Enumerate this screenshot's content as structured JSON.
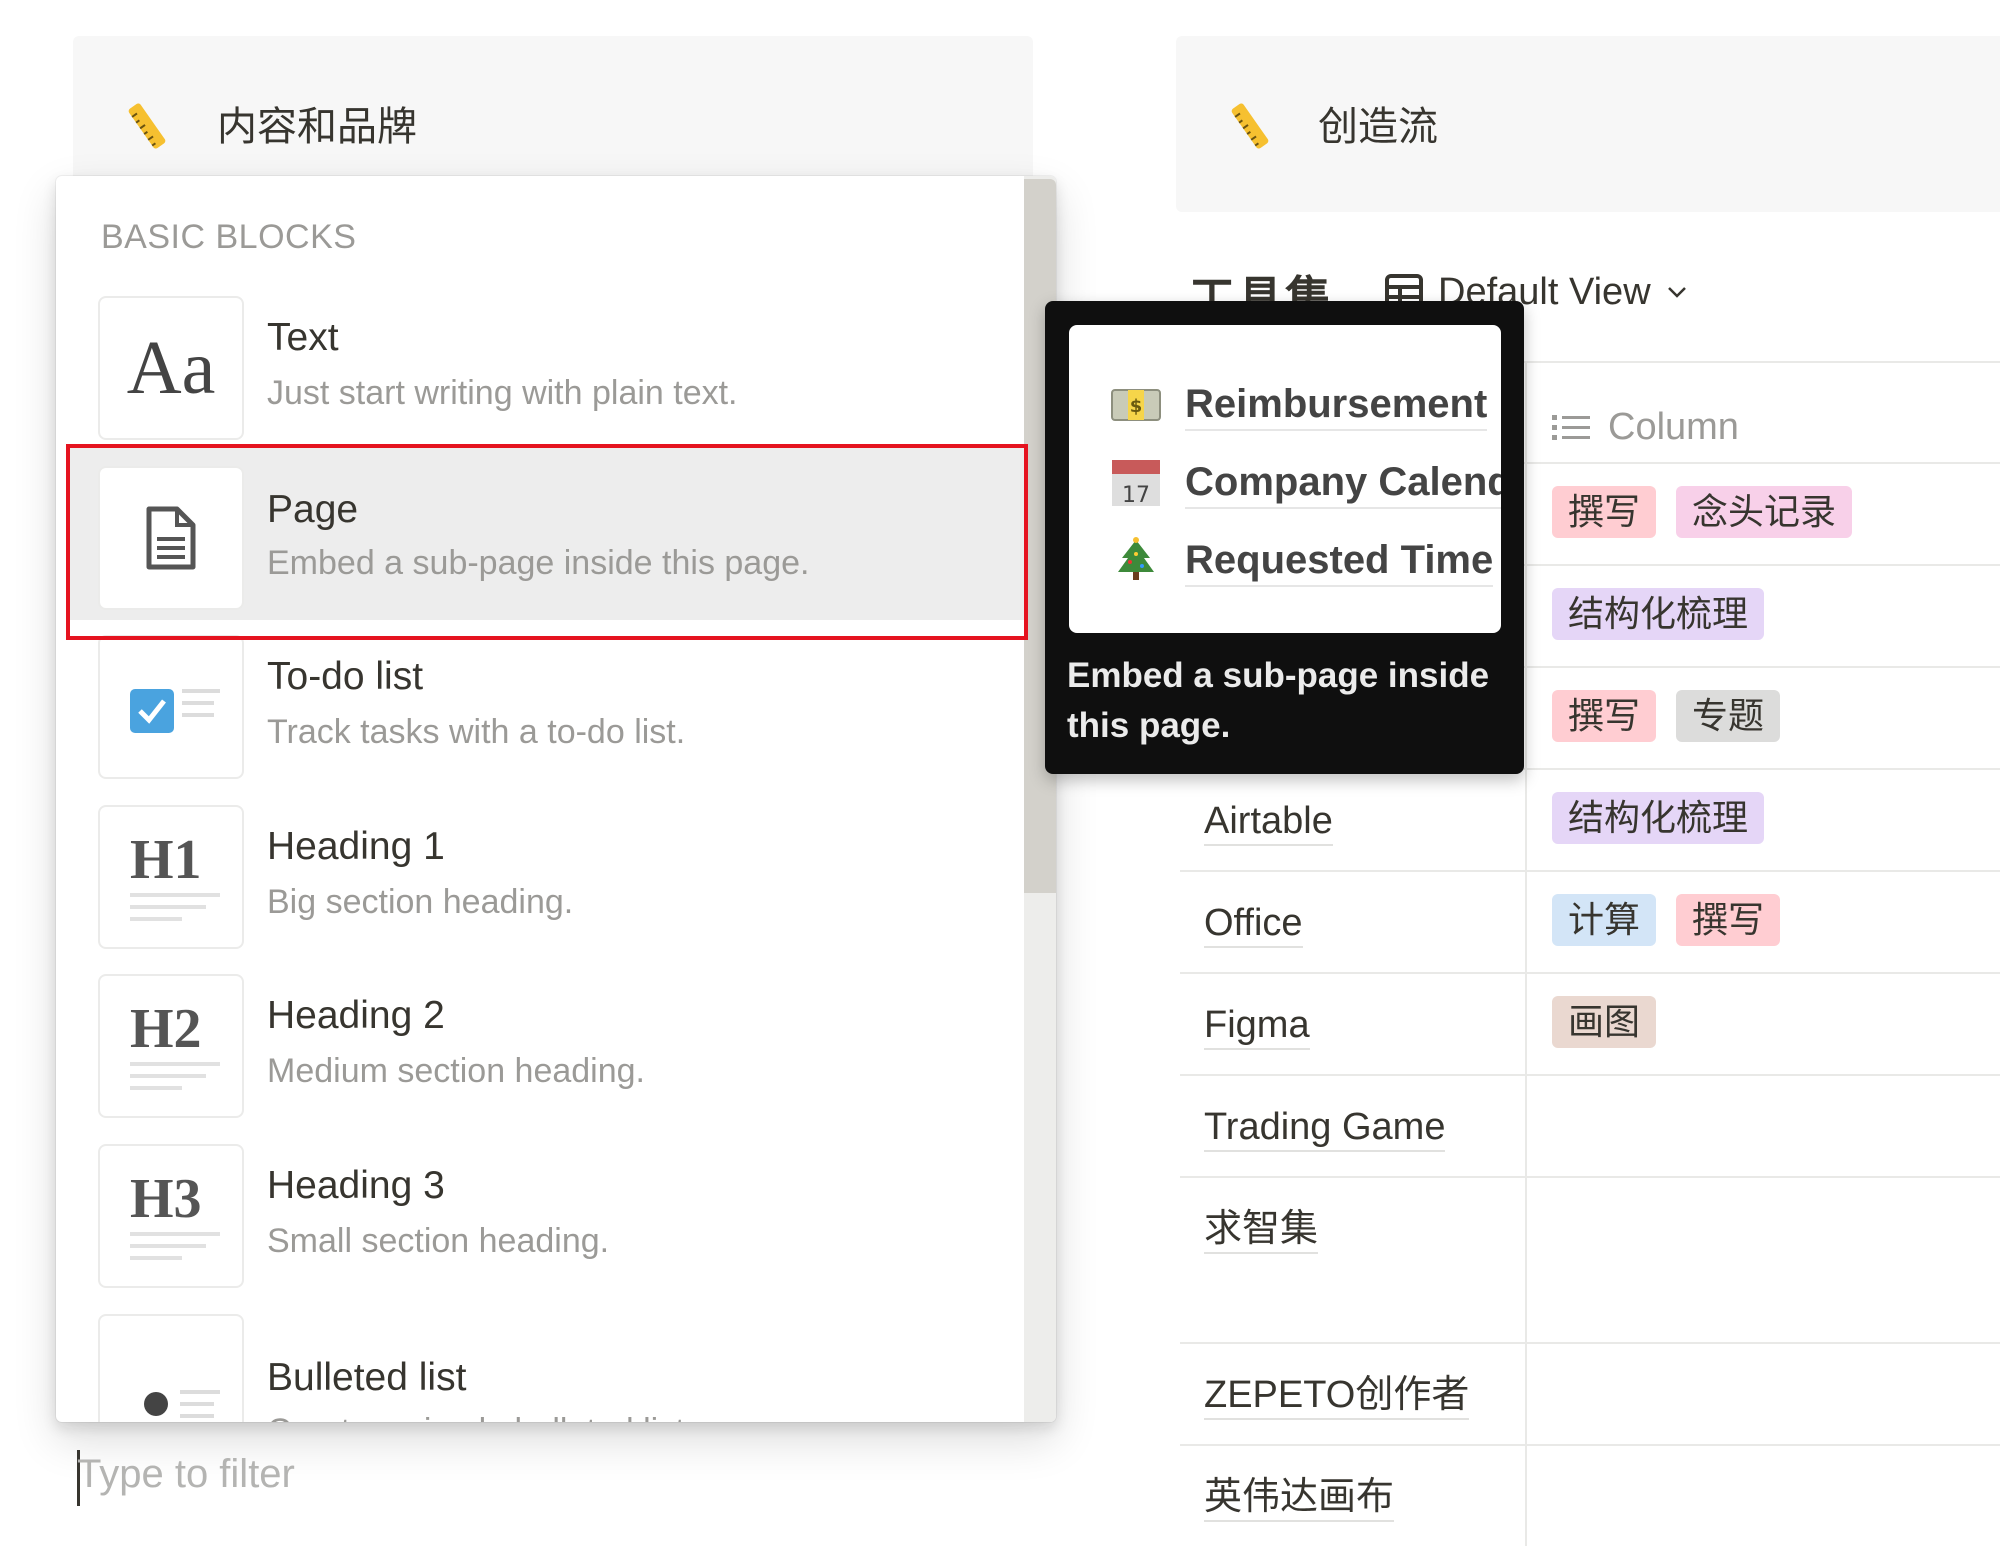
{
  "cards": [
    {
      "icon": "ruler-icon",
      "title": "内容和品牌"
    },
    {
      "icon": "ruler-icon",
      "title": "创造流"
    }
  ],
  "database": {
    "title": "工具集",
    "view": {
      "icon": "table-icon",
      "label": "Default View"
    },
    "column_header": {
      "icon": "multi-select-icon",
      "label": "Column"
    },
    "rows": [
      {
        "name": "",
        "tags": [
          {
            "label": "撰写",
            "color": "#ffcdd2"
          },
          {
            "label": "念头记录",
            "color": "#f8d0e9"
          }
        ]
      },
      {
        "name": "",
        "tags": [
          {
            "label": "结构化梳理",
            "color": "#e5d6f7"
          }
        ]
      },
      {
        "name": "",
        "tags": [
          {
            "label": "撰写",
            "color": "#ffcdd2"
          },
          {
            "label": "专题",
            "color": "#dcdcdb"
          }
        ]
      },
      {
        "name": "Airtable",
        "tags": [
          {
            "label": "结构化梳理",
            "color": "#e5d6f7"
          }
        ]
      },
      {
        "name": "Office",
        "tags": [
          {
            "label": "计算",
            "color": "#d3e5f7"
          },
          {
            "label": "撰写",
            "color": "#ffcdd2"
          }
        ]
      },
      {
        "name": "Figma",
        "tags": [
          {
            "label": "画图",
            "color": "#ead8d0"
          }
        ]
      },
      {
        "name": "Trading Game",
        "tags": []
      },
      {
        "name": "求智集",
        "tags": []
      },
      {
        "name": "ZEPETO创作者",
        "tags": []
      },
      {
        "name": "英伟达画布",
        "tags": []
      }
    ]
  },
  "menu": {
    "section": "BASIC BLOCKS",
    "selected_index": 1,
    "items": [
      {
        "icon": "text-icon",
        "glyph": "Aa",
        "title": "Text",
        "description": "Just start writing with plain text."
      },
      {
        "icon": "page-icon",
        "glyph": "",
        "title": "Page",
        "description": "Embed a sub-page inside this page."
      },
      {
        "icon": "todo-checkbox-icon",
        "glyph": "",
        "title": "To-do list",
        "description": "Track tasks with a to-do list."
      },
      {
        "icon": "heading-1-icon",
        "glyph": "H1",
        "title": "Heading 1",
        "description": "Big section heading."
      },
      {
        "icon": "heading-2-icon",
        "glyph": "H2",
        "title": "Heading 2",
        "description": "Medium section heading."
      },
      {
        "icon": "heading-3-icon",
        "glyph": "H3",
        "title": "Heading 3",
        "description": "Small section heading."
      },
      {
        "icon": "bulleted-list-icon",
        "glyph": "",
        "title": "Bulleted list",
        "description": "Create a simple bulleted list."
      }
    ],
    "filter_placeholder": "Type to filter"
  },
  "tooltip": {
    "preview_items": [
      {
        "icon": "money-icon",
        "label": "Reimbursement"
      },
      {
        "icon": "calendar-icon",
        "calendar_day": "17",
        "label": "Company Calendar"
      },
      {
        "icon": "christmas-tree-icon",
        "label": "Requested Time"
      }
    ],
    "caption": "Embed a sub-page inside this page."
  },
  "colors": {
    "selection_outline": "#e5131f",
    "checkbox_blue": "#4aa3df",
    "ruler_yellow": "#f6c030"
  }
}
